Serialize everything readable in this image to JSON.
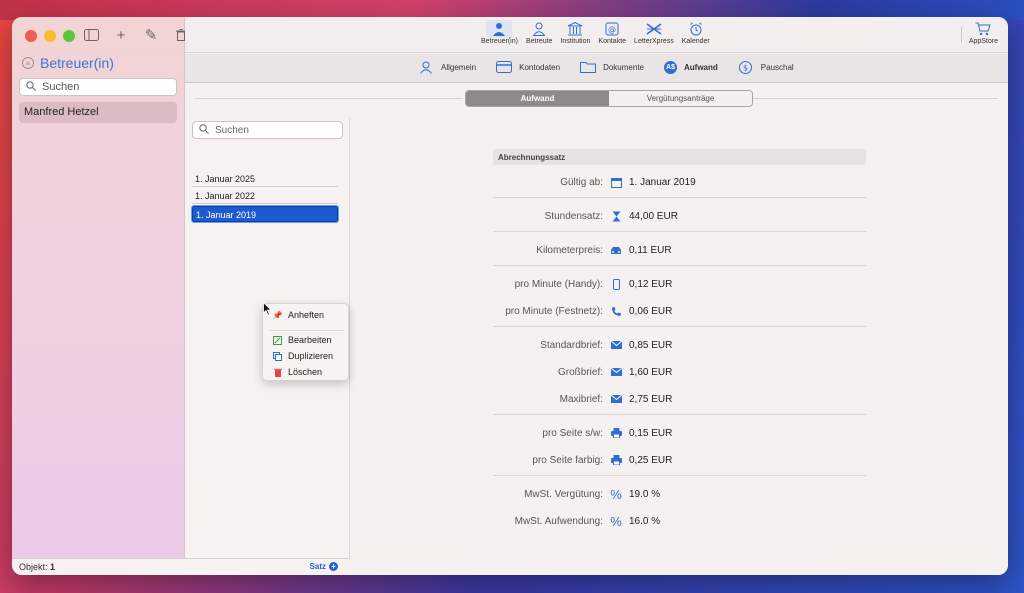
{
  "sidebar": {
    "title": "Betreuer(in)",
    "search_placeholder": "Suchen",
    "items": [
      {
        "label": "Manfred Hetzel"
      }
    ],
    "footer_label": "Objekt:",
    "footer_count": "1"
  },
  "toolbar": {
    "items": [
      {
        "label": "Betreuer(in)",
        "icon": "person-icon",
        "active": true
      },
      {
        "label": "Betreute",
        "icon": "person-outline-icon",
        "active": false
      },
      {
        "label": "Institution",
        "icon": "institution-icon",
        "active": false
      },
      {
        "label": "Kontakte",
        "icon": "contacts-icon",
        "active": false
      },
      {
        "label": "LetterXpress",
        "icon": "letterxpress-icon",
        "active": false
      },
      {
        "label": "Kalender",
        "icon": "alarm-clock-icon",
        "active": false
      }
    ],
    "appstore_label": "AppStore"
  },
  "subtabs": [
    {
      "label": "Allgemein",
      "icon": "person-icon",
      "active": false
    },
    {
      "label": "Kontodaten",
      "icon": "card-icon",
      "active": false
    },
    {
      "label": "Dokumente",
      "icon": "folder-icon",
      "active": false
    },
    {
      "label": "Aufwand",
      "icon": "aufwand-icon",
      "active": true
    },
    {
      "label": "Pauschal",
      "icon": "dollar-icon",
      "active": false
    }
  ],
  "segments": {
    "left": "Aufwand",
    "right": "Vergütungsanträge"
  },
  "list": {
    "search_placeholder": "Suchen",
    "items": [
      "1. Januar 2025",
      "1. Januar 2022",
      "1. Januar 2019"
    ],
    "add_label": "Satz"
  },
  "context_menu": {
    "items": [
      "Anheften",
      "Bearbeiten",
      "Duplizieren",
      "Löschen"
    ]
  },
  "detail": {
    "section_title": "Abrechnungssatz",
    "rows": [
      {
        "label": "Gültig ab:",
        "value": "1. Januar 2019",
        "icon": "calendar-icon"
      },
      {
        "label": "Stundensatz:",
        "value": "44,00 EUR",
        "icon": "hourglass-icon"
      },
      {
        "label": "Kilometerpreis:",
        "value": "0,11 EUR",
        "icon": "car-icon"
      },
      {
        "label": "pro Minute (Handy):",
        "value": "0,12 EUR",
        "icon": "mobile-phone-icon"
      },
      {
        "label": "pro Minute (Festnetz):",
        "value": "0,06 EUR",
        "icon": "phone-icon"
      },
      {
        "label": "Standardbrief:",
        "value": "0,85 EUR",
        "icon": "envelope-icon"
      },
      {
        "label": "Großbrief:",
        "value": "1,60 EUR",
        "icon": "envelope-icon"
      },
      {
        "label": "Maxibrief:",
        "value": "2,75 EUR",
        "icon": "envelope-icon"
      },
      {
        "label": "pro Seite s/w:",
        "value": "0,15 EUR",
        "icon": "printer-icon"
      },
      {
        "label": "pro Seite farbig:",
        "value": "0,25 EUR",
        "icon": "printer-icon"
      },
      {
        "label": "MwSt. Vergütung:",
        "value": "19.0 %",
        "icon": "percent-icon"
      },
      {
        "label": "MwSt. Aufwendung:",
        "value": "16.0 %",
        "icon": "percent-icon"
      }
    ]
  },
  "colors": {
    "accent": "#2f6fd0",
    "selection": "#1e5bd0"
  }
}
